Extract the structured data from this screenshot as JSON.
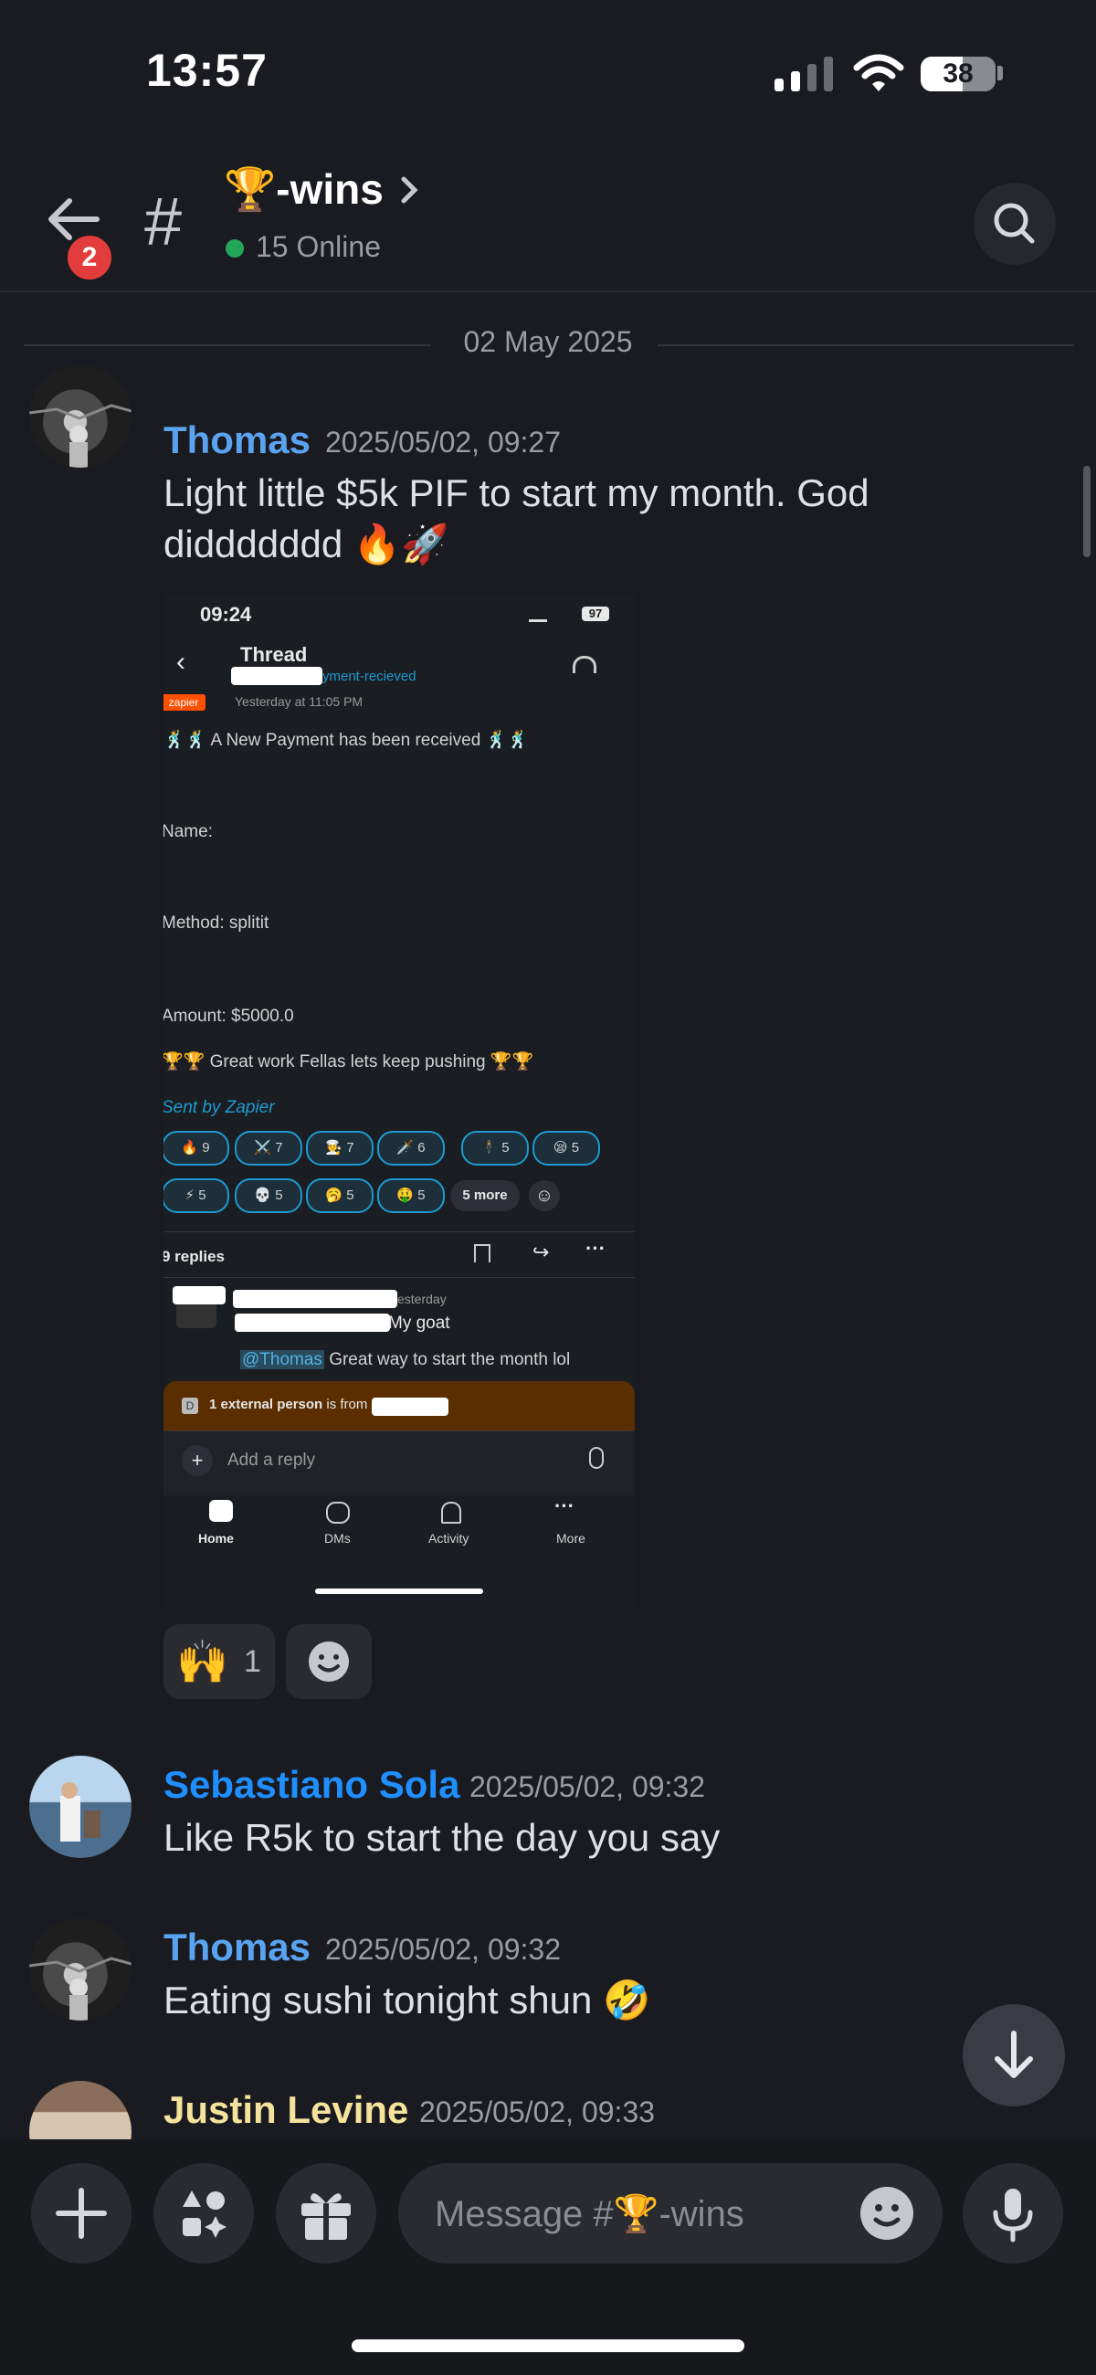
{
  "status_bar": {
    "time": "13:57",
    "battery": "38"
  },
  "header": {
    "back_badge": "2",
    "channel_name": "🏆-wins",
    "online_text": "15 Online"
  },
  "date_divider": "02 May 2025",
  "messages": [
    {
      "author": "Thomas",
      "timestamp": "2025/05/02, 09:27",
      "text_line1": "Light little $5k PIF to start my month. God",
      "text_line2": "diddddddd 🔥🚀",
      "reactions": [
        {
          "emoji": "🙌",
          "count": "1"
        }
      ]
    },
    {
      "author": "Sebastiano Sola",
      "timestamp": "2025/05/02, 09:32",
      "text": "Like R5k to start the day you say"
    },
    {
      "author": "Thomas",
      "timestamp": "2025/05/02, 09:32",
      "text": "Eating sushi tonight shun 🤣"
    },
    {
      "author": "Justin Levine",
      "timestamp": "2025/05/02, 09:33"
    }
  ],
  "embedded_screenshot": {
    "time": "09:24",
    "battery": "97",
    "thread_title": "Thread",
    "channel_suffix": "yment-recieved",
    "app_tag": "zapier",
    "posted_at": "Yesterday at 11:05 PM",
    "headline": "🕺🕺  A New Payment has been received 🕺🕺",
    "name_label": "Name:",
    "method_label": "Method: splitit",
    "amount_label": "Amount: $5000.0",
    "great_work": "🏆🏆 Great work Fellas lets keep pushing 🏆🏆",
    "sent_by": "Sent by Zapier",
    "reaction_row1": [
      {
        "emoji": "🔥",
        "count": "9"
      },
      {
        "emoji": "⚔️",
        "count": "7"
      },
      {
        "emoji": "🧑‍🍳",
        "count": "7"
      },
      {
        "emoji": "🗡️",
        "count": "6"
      },
      {
        "emoji": "🕴️",
        "count": "5"
      },
      {
        "emoji": "😪",
        "count": "5"
      }
    ],
    "reaction_row2": [
      {
        "emoji": "⚡",
        "count": "5"
      },
      {
        "emoji": "💀",
        "count": "5"
      },
      {
        "emoji": "🥱",
        "count": "5"
      },
      {
        "emoji": "🤑",
        "count": "5"
      }
    ],
    "more_label": "5 more",
    "replies_label": "9 replies",
    "reply_time": "esterday",
    "reply_text": "My goat",
    "mention": "@Thomas",
    "mention_text": " Great way to start the month lol",
    "external_bold": "1 external person",
    "external_rest": " is from",
    "ext_icon": "D",
    "reply_placeholder": "Add a reply",
    "tabs": [
      "Home",
      "DMs",
      "Activity",
      "More"
    ]
  },
  "composer": {
    "placeholder": "Message #🏆-wins"
  },
  "colors": {
    "thomas": "#5aa3f0",
    "sebastiano": "#1f8fff",
    "justin": "#f5e29b",
    "online": "#23a55a"
  }
}
